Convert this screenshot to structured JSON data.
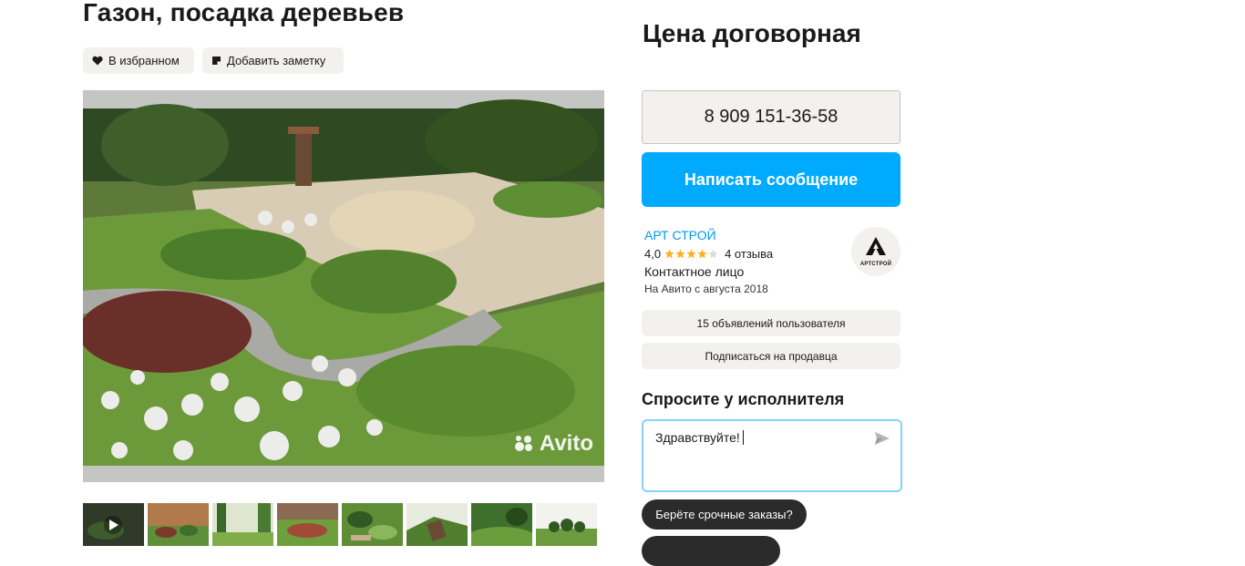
{
  "listing": {
    "title": "Газон, посадка деревьев",
    "favorite_label": "В избранном",
    "note_label": "Добавить заметку",
    "watermark": "Avito"
  },
  "sidebar": {
    "price": "Цена договорная",
    "phone": "8 909 151-36-58",
    "message_label": "Написать сообщение",
    "seller": {
      "name": "АРТ СТРОЙ",
      "rating": "4,0",
      "rating_value": 4,
      "reviews": "4 отзыва",
      "contact": "Контактное лицо",
      "since": "На Авито с августа 2018",
      "avatar_text": "АРТСТРОЙ"
    },
    "listings_label": "15 объявлений пользователя",
    "subscribe_label": "Подписаться на продавца",
    "ask": {
      "heading": "Спросите у исполнителя",
      "value": "Здравствуйте!",
      "quick_questions": [
        "Берёте срочные заказы?",
        ""
      ]
    }
  },
  "colors": {
    "accent": "#00aaff",
    "link": "#0099f7",
    "star": "#ffb021",
    "button_bg": "#f2f1ed",
    "dark_chip": "#2b2b2b"
  }
}
